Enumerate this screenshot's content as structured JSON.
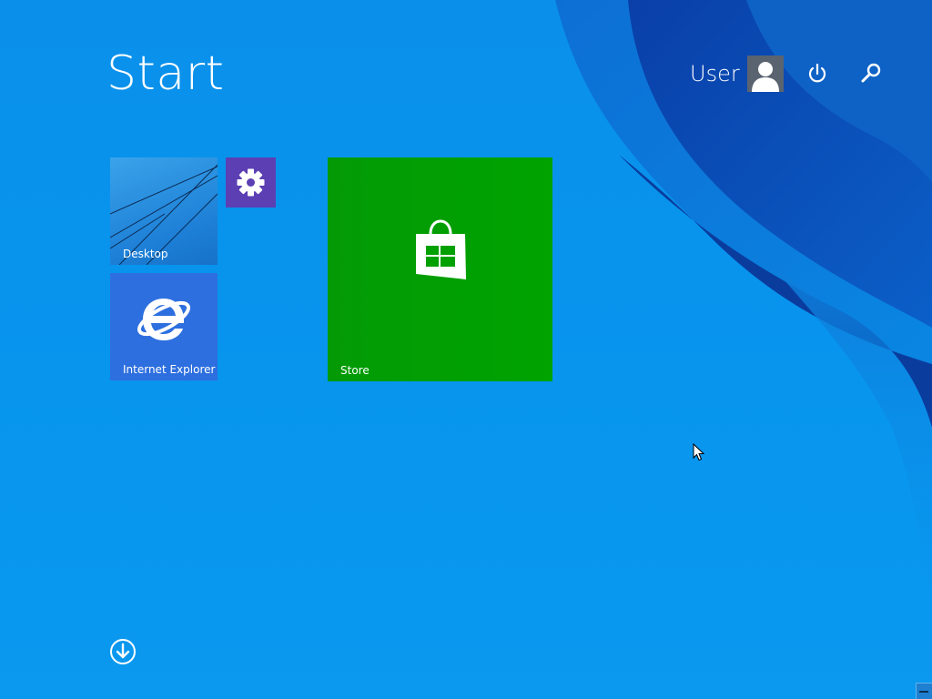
{
  "header": {
    "title": "Start",
    "user_name": "User"
  },
  "icons": {
    "avatar": "user-avatar-icon",
    "power": "power-icon",
    "search": "search-icon",
    "settings": "gear-icon",
    "internet_explorer": "internet-explorer-icon",
    "store": "store-bag-icon",
    "all_apps": "down-arrow-circle-icon"
  },
  "tiles": {
    "desktop": {
      "label": "Desktop"
    },
    "settings": {
      "label": ""
    },
    "internet_explorer": {
      "label": "Internet Explorer"
    },
    "store": {
      "label": "Store"
    }
  },
  "colors": {
    "background": "#0a8de8",
    "settings_tile": "#5c3fb3",
    "ie_tile": "#2d6fdf",
    "store_tile": "#00a300",
    "desktop_tile": "#1d7fd6"
  }
}
